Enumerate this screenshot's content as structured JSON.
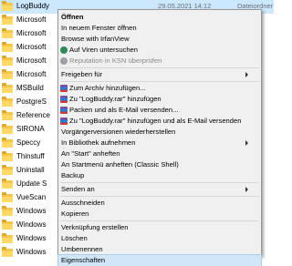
{
  "explorer": {
    "rows": [
      {
        "name": "LogBuddy",
        "date": "29.05.2021 14:12",
        "type": "Dateiordner",
        "selected": true
      },
      {
        "name": "Microsoft",
        "date": "",
        "type": "",
        "selected": false
      },
      {
        "name": "Microsoft",
        "date": "",
        "type": "",
        "selected": false
      },
      {
        "name": "Microsoft",
        "date": "",
        "type": "",
        "selected": false
      },
      {
        "name": "Microsoft",
        "date": "",
        "type": "",
        "selected": false
      },
      {
        "name": "Microsoft",
        "date": "",
        "type": "",
        "selected": false
      },
      {
        "name": "MSBuild",
        "date": "",
        "type": "",
        "selected": false
      },
      {
        "name": "PostgreS",
        "date": "",
        "type": "",
        "selected": false
      },
      {
        "name": "Reference",
        "date": "",
        "type": "",
        "selected": false
      },
      {
        "name": "SIRONA",
        "date": "",
        "type": "",
        "selected": false
      },
      {
        "name": "Speccy",
        "date": "",
        "type": "",
        "selected": false
      },
      {
        "name": "Thinstuff",
        "date": "",
        "type": "",
        "selected": false
      },
      {
        "name": "Uninstall",
        "date": "",
        "type": "",
        "selected": false
      },
      {
        "name": "Update S",
        "date": "",
        "type": "",
        "selected": false
      },
      {
        "name": "VueScan",
        "date": "",
        "type": "",
        "selected": false
      },
      {
        "name": "Windows",
        "date": "",
        "type": "",
        "selected": false
      },
      {
        "name": "Windows",
        "date": "",
        "type": "",
        "selected": false
      },
      {
        "name": "Windows",
        "date": "",
        "type": "",
        "selected": false
      },
      {
        "name": "Windows",
        "date": "",
        "type": "",
        "selected": false
      }
    ]
  },
  "menu": {
    "items": [
      {
        "label": "Öffnen",
        "bold": true
      },
      {
        "label": "In neuem Fenster öffnen"
      },
      {
        "label": "Browse with IrfanView"
      },
      {
        "label": "Auf Viren untersuchen",
        "icon": "shield-virus-icon"
      },
      {
        "label": "Reputation in KSN überprüfen",
        "icon": "ksn-icon",
        "disabled": true
      },
      {
        "label": "Freigeben für",
        "submenu": true
      },
      {
        "label": "Zum Archiv hinzufügen...",
        "icon": "winrar-icon"
      },
      {
        "label": "Zu \"LogBuddy.rar\" hinzufügen",
        "icon": "winrar-icon"
      },
      {
        "label": "Packen und als E-Mail versenden...",
        "icon": "winrar-icon"
      },
      {
        "label": "Zu \"LogBuddy.rar\" hinzufügen und als E-Mail versenden",
        "icon": "winrar-icon"
      },
      {
        "label": "Vorgängerversionen wiederherstellen"
      },
      {
        "label": "In Bibliothek aufnehmen",
        "submenu": true
      },
      {
        "label": "An \"Start\" anheften"
      },
      {
        "label": "An Startmenü anheften (Classic Shell)"
      },
      {
        "label": "Backup"
      },
      {
        "label": "Senden an",
        "submenu": true
      },
      {
        "label": "Ausschneiden"
      },
      {
        "label": "Kopieren"
      },
      {
        "label": "Verknüpfung erstellen"
      },
      {
        "label": "Löschen"
      },
      {
        "label": "Umbenennen"
      },
      {
        "label": "Eigenschaften",
        "hover": true
      }
    ]
  },
  "colors": {
    "selection": "#cce8ff",
    "menu_background": "#f0f0f0",
    "hover": "#d1e6f7"
  }
}
